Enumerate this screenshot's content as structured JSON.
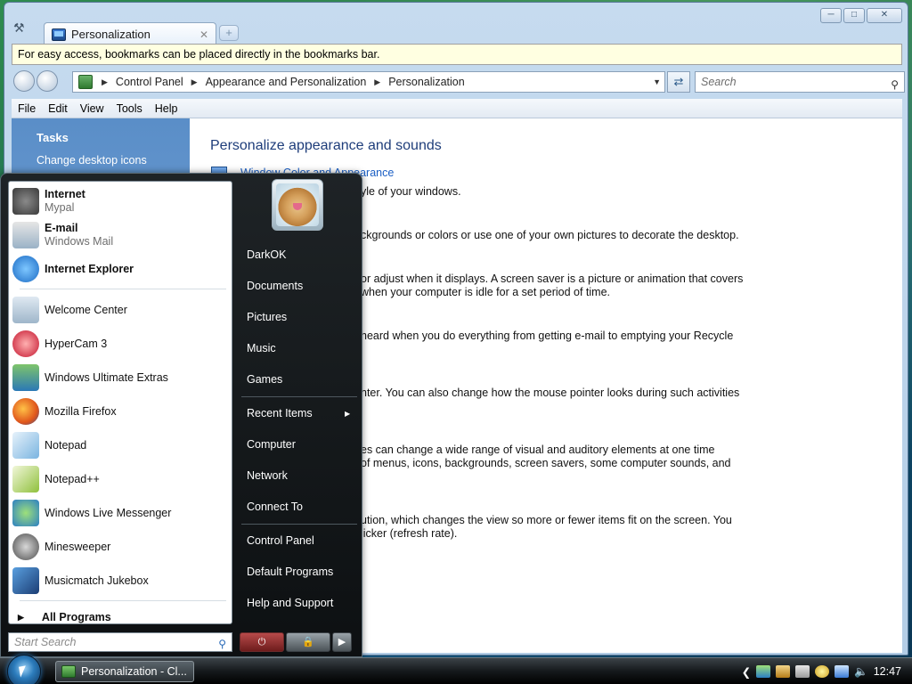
{
  "window": {
    "tab_title": "Personalization",
    "infobar": "For easy access, bookmarks can be placed directly in the bookmarks bar.",
    "breadcrumb": [
      "Control Panel",
      "Appearance and Personalization",
      "Personalization"
    ],
    "search_placeholder": "Search",
    "menu": [
      "File",
      "Edit",
      "View",
      "Tools",
      "Help"
    ]
  },
  "sidebar": {
    "heading": "Tasks",
    "link": "Change desktop icons"
  },
  "content": {
    "title": "Personalize appearance and sounds",
    "link": "Window Color and Appearance",
    "lines": [
      "yle of your windows.",
      "ckgrounds or colors or use one of your own pictures to decorate the desktop.",
      "or adjust when it displays. A screen saver is a picture or animation that covers",
      "when your computer is idle for a set period of time.",
      "heard when you do everything from getting e-mail to emptying your Recycle",
      "nter. You can also change how the mouse pointer looks during such activities",
      "es can change a wide range of visual and auditory elements at one time",
      "of menus, icons, backgrounds, screen savers, some computer sounds, and",
      "ution, which changes the view so more or fewer items fit on the screen. You",
      "licker (refresh rate)."
    ]
  },
  "start_menu": {
    "pinned": [
      {
        "label": "Internet",
        "sub": "Mypal"
      },
      {
        "label": "E-mail",
        "sub": "Windows Mail"
      },
      {
        "label": "Internet Explorer",
        "sub": ""
      }
    ],
    "recent": [
      "Welcome Center",
      "HyperCam 3",
      "Windows Ultimate Extras",
      "Mozilla Firefox",
      "Notepad",
      "Notepad++",
      "Windows Live Messenger",
      "Minesweeper",
      "Musicmatch Jukebox"
    ],
    "all_programs": "All Programs",
    "search_placeholder": "Start Search",
    "right": {
      "user": "DarkOK",
      "documents": "Documents",
      "pictures": "Pictures",
      "music": "Music",
      "games": "Games",
      "recent_items": "Recent Items",
      "computer": "Computer",
      "network": "Network",
      "connect_to": "Connect To",
      "control_panel": "Control Panel",
      "default_programs": "Default Programs",
      "help_support": "Help and Support"
    }
  },
  "taskbar": {
    "task": "Personalization - Cl...",
    "clock": "12:47"
  },
  "icons": [
    "wrench-icon",
    "tab-icon",
    "close-icon",
    "new-tab-icon",
    "back-icon",
    "forward-icon",
    "control-panel-icon",
    "refresh-icon",
    "search-icon",
    "start-orb-icon",
    "power-icon",
    "lock-icon"
  ]
}
